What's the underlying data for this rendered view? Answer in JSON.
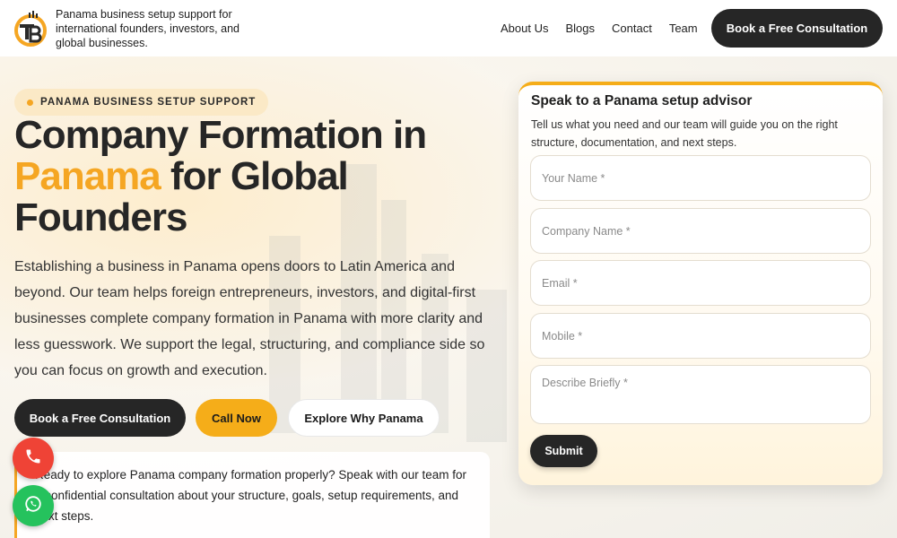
{
  "header": {
    "tagline": "Panama business setup support for international founders, investors, and global businesses.",
    "nav": [
      "About Us",
      "Blogs",
      "Contact",
      "Team"
    ],
    "cta_label": "Book a Free Consultation"
  },
  "hero": {
    "badge": "PANAMA BUSINESS SETUP SUPPORT",
    "title_part1": "Company Formation in ",
    "title_accent": "Panama",
    "title_part2": " for Global Founders",
    "description": "Establishing a business in Panama opens doors to Latin America and beyond. Our team helps foreign entrepreneurs, investors, and digital-first businesses complete company formation in Panama with more clarity and less guesswork. We support the legal, structuring, and compliance side so you can focus on growth and execution.",
    "buttons": {
      "primary": "Book a Free Consultation",
      "call": "Call Now",
      "explore": "Explore Why Panama"
    },
    "info_card": "Ready to explore Panama company formation properly? Speak with our team for a confidential consultation about your structure, goals, setup requirements, and next steps."
  },
  "form": {
    "title": "Speak to a Panama setup advisor",
    "subtitle": "Tell us what you need and our team will guide you on the right structure, documentation, and next steps.",
    "fields": {
      "name_placeholder": "Your Name *",
      "company_placeholder": "Company Name *",
      "email_placeholder": "Email *",
      "mobile_placeholder": "Mobile *",
      "describe_placeholder": "Describe Briefly *"
    },
    "submit_label": "Submit"
  },
  "colors": {
    "accent": "#f5a623",
    "dark": "#262626",
    "phone_fab": "#ef4336",
    "whatsapp_fab": "#25c25d"
  },
  "icons": {
    "logo": "tb-logo-icon",
    "phone": "phone-icon",
    "whatsapp": "whatsapp-icon"
  }
}
